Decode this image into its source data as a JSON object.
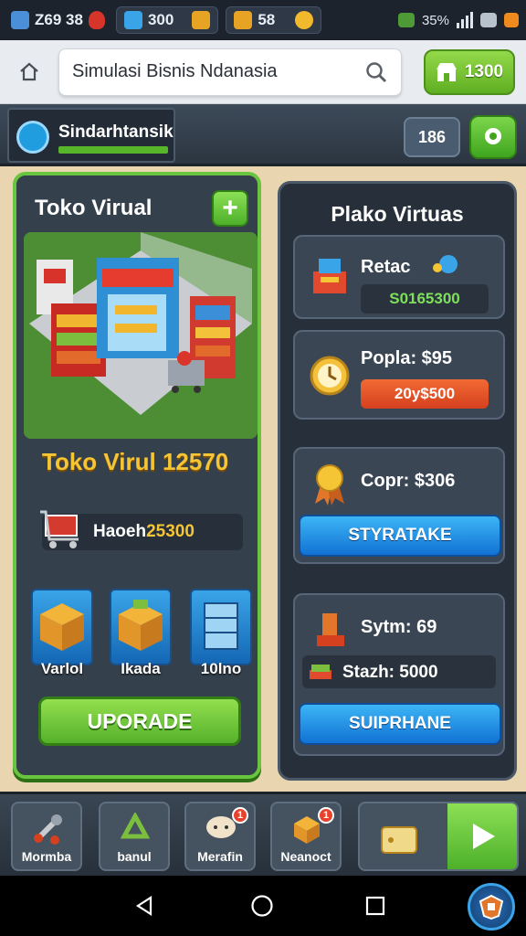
{
  "status_bar": {
    "time": "Z69 38",
    "chips": [
      {
        "value": "300",
        "icon": "card-icon"
      },
      {
        "value": "58",
        "icon": "crate-icon"
      }
    ],
    "battery_text": "35%"
  },
  "browser": {
    "url_text": "Simulasi Bisnis Ndanasia",
    "coin_label": "1300"
  },
  "game_header": {
    "title": "Sindarhtansik",
    "count": "186"
  },
  "store_panel": {
    "title": "Toko Virual",
    "plus_label": "+",
    "store_name": "Toko Virul 12570",
    "cash_label": "Haoeh ",
    "cash_value": "25300",
    "categories": [
      {
        "label": "Varlol",
        "icon": "box-icon"
      },
      {
        "label": "Ikada",
        "icon": "box-icon"
      },
      {
        "label": "10lno",
        "icon": "cabinet-icon"
      }
    ],
    "upgrade_label": "UPORADE"
  },
  "stats_panel": {
    "title": "Plako Virtuas",
    "cards": [
      {
        "label": "Retac",
        "value": "S0165300",
        "icon": "register-icon"
      },
      {
        "label": "Popla: $95",
        "value": "20y$500",
        "icon": "clock-icon"
      },
      {
        "label": "Copr: $306",
        "button": "STYRATAKE",
        "icon": "medal-icon"
      },
      {
        "label": "Sytm: 69",
        "sub": "Stazh: 5000",
        "button": "SUIPRHANE",
        "icon": "boot-icon"
      }
    ]
  },
  "bottom_nav": {
    "items": [
      {
        "label": "Mormba",
        "icon": "wrench-icon"
      },
      {
        "label": "banul",
        "icon": "recycle-icon"
      },
      {
        "label": "Merafin",
        "icon": "chat-icon",
        "badge": "1"
      },
      {
        "label": "Neanoct",
        "icon": "package-icon",
        "badge": "1"
      }
    ]
  },
  "colors": {
    "panel_green": "#69c43f",
    "button_blue": "#1e8fe6",
    "gold": "#f6c535"
  }
}
